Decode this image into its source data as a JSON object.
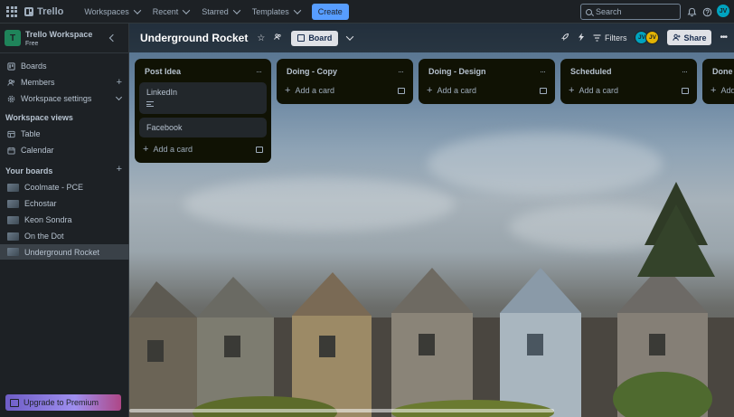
{
  "topbar": {
    "app_name": "Trello",
    "nav": [
      {
        "label": "Workspaces"
      },
      {
        "label": "Recent"
      },
      {
        "label": "Starred"
      },
      {
        "label": "Templates"
      }
    ],
    "create_label": "Create",
    "search_placeholder": "Search",
    "user_initials": "JV"
  },
  "sidebar": {
    "workspace_name": "Trello Workspace",
    "workspace_initial": "T",
    "workspace_plan": "Free",
    "items": [
      {
        "label": "Boards"
      },
      {
        "label": "Members"
      },
      {
        "label": "Workspace settings"
      }
    ],
    "views_heading": "Workspace views",
    "views": [
      {
        "label": "Table"
      },
      {
        "label": "Calendar"
      }
    ],
    "boards_heading": "Your boards",
    "boards": [
      {
        "label": "Coolmate - PCE"
      },
      {
        "label": "Echostar"
      },
      {
        "label": "Keon Sondra"
      },
      {
        "label": "On the Dot"
      },
      {
        "label": "Underground Rocket"
      }
    ],
    "upgrade_label": "Upgrade to Premium"
  },
  "board": {
    "title": "Underground Rocket",
    "view_label": "Board",
    "filters_label": "Filters",
    "share_label": "Share",
    "member_initials": [
      "JV",
      "JV"
    ],
    "add_card_label": "Add a card",
    "lists": [
      {
        "title": "Post Idea",
        "cards": [
          {
            "title": "LinkedIn",
            "has_description": true
          },
          {
            "title": "Facebook",
            "has_description": false
          }
        ]
      },
      {
        "title": "Doing - Copy",
        "cards": []
      },
      {
        "title": "Doing - Design",
        "cards": []
      },
      {
        "title": "Scheduled",
        "cards": []
      },
      {
        "title": "Done",
        "cards": []
      }
    ]
  },
  "colors": {
    "accent": "#579dff",
    "workspace_badge": "#1f845a",
    "list_bg": "#101204",
    "card_bg": "#22272b"
  }
}
